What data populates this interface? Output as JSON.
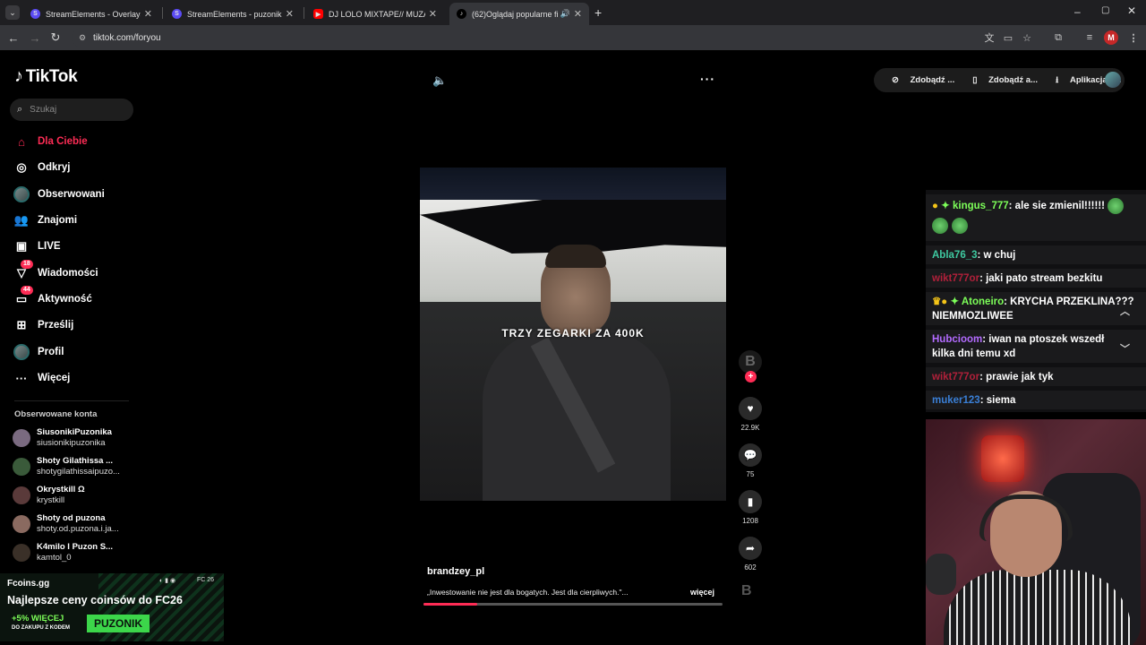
{
  "browser": {
    "tabs": [
      {
        "title": "StreamElements - Overlays",
        "icon": "streamelements-icon",
        "color": "#5b4bf5"
      },
      {
        "title": "StreamElements - puzonik",
        "icon": "streamelements-icon",
        "color": "#5b4bf5"
      },
      {
        "title": "DJ LOLO MIXTAPE// MUZA DO",
        "icon": "youtube-icon",
        "color": "#ff0000"
      },
      {
        "title": "(62)Oglądaj popularne film",
        "icon": "tiktok-icon",
        "color": "#ffffff"
      }
    ],
    "url": "tiktok.com/foryou",
    "profile_initial": "M"
  },
  "tiktok": {
    "logo_text": "TikTok",
    "search_placeholder": "Szukaj",
    "nav": [
      {
        "label": "Dla Ciebie",
        "icon": "home-icon",
        "active": true
      },
      {
        "label": "Odkryj",
        "icon": "compass-icon"
      },
      {
        "label": "Obserwowani",
        "icon": "avatar-icon"
      },
      {
        "label": "Znajomi",
        "icon": "friends-icon"
      },
      {
        "label": "LIVE",
        "icon": "live-icon"
      },
      {
        "label": "Wiadomości",
        "icon": "inbox-icon",
        "badge": "18"
      },
      {
        "label": "Aktywność",
        "icon": "activity-icon",
        "badge": "44"
      },
      {
        "label": "Prześlij",
        "icon": "upload-icon"
      },
      {
        "label": "Profil",
        "icon": "profile-icon"
      },
      {
        "label": "Więcej",
        "icon": "more-icon"
      }
    ],
    "following_title": "Obserwowane konta",
    "following": [
      {
        "name": "SiusonikiPuzonika",
        "handle": "siusionikipuzonika",
        "color": "#7a6a80"
      },
      {
        "name": "Shoty Gilathissa ...",
        "handle": "shotygilathissaipuzo...",
        "color": "#3a5a3a"
      },
      {
        "name": "Okrystkill Ω",
        "handle": "krystkill",
        "color": "#5a3a3a"
      },
      {
        "name": "Shoty od puzona",
        "handle": "shoty.od.puzona.i.ja...",
        "color": "#8a6a60"
      },
      {
        "name": "K4milo I Puzon S...",
        "handle": "kamtol_0",
        "color": "#3a3028"
      }
    ],
    "video": {
      "caption": "TRZY ZEGARKI ZA 400K",
      "author": "brandzey_pl",
      "description": "„Inwestowanie nie jest dla bogatych. Jest dla cierpliwych.\"...",
      "more": "więcej",
      "progress": 0.18,
      "likes": "22.9K",
      "comments": "75",
      "saves": "1208",
      "shares": "602",
      "creator_initial": "B"
    },
    "top_actions": [
      "Zdobądź ...",
      "Zdobądź a...",
      "Aplikacja k..."
    ]
  },
  "chat": [
    {
      "user": "kingus_777",
      "color": "#7dff59",
      "text": ": ale sie zmienil!!!!!!",
      "emotes": 3
    },
    {
      "user": "Abla76_3",
      "color": "#3ec9a0",
      "text": ": w chuj"
    },
    {
      "user": "wikt777or",
      "color": "#b0203a",
      "text": ": jaki pato stream bezkitu"
    },
    {
      "user": "Atoneiro",
      "color": "#7dff59",
      "text": ": KRYCHA PRZEKLINA??? NIEMMOZLIWEE"
    },
    {
      "user": "Hubcioom",
      "color": "#b36bff",
      "text": ": iwan na ptoszek wszedł kilka dni temu xd"
    },
    {
      "user": "wikt777or",
      "color": "#b0203a",
      "text": ": prawie jak tyk"
    },
    {
      "user": "muker123",
      "color": "#3a7fd6",
      "text": ": siema"
    }
  ],
  "ad": {
    "brand": "Fcoins.gg",
    "game": "FC 26",
    "headline": "Najlepsze ceny coinsów do FC26",
    "bonus": "+5% WIĘCEJ",
    "bonus_sub": "DO ZAKUPU Z KODEM",
    "code": "PUZONIK"
  }
}
